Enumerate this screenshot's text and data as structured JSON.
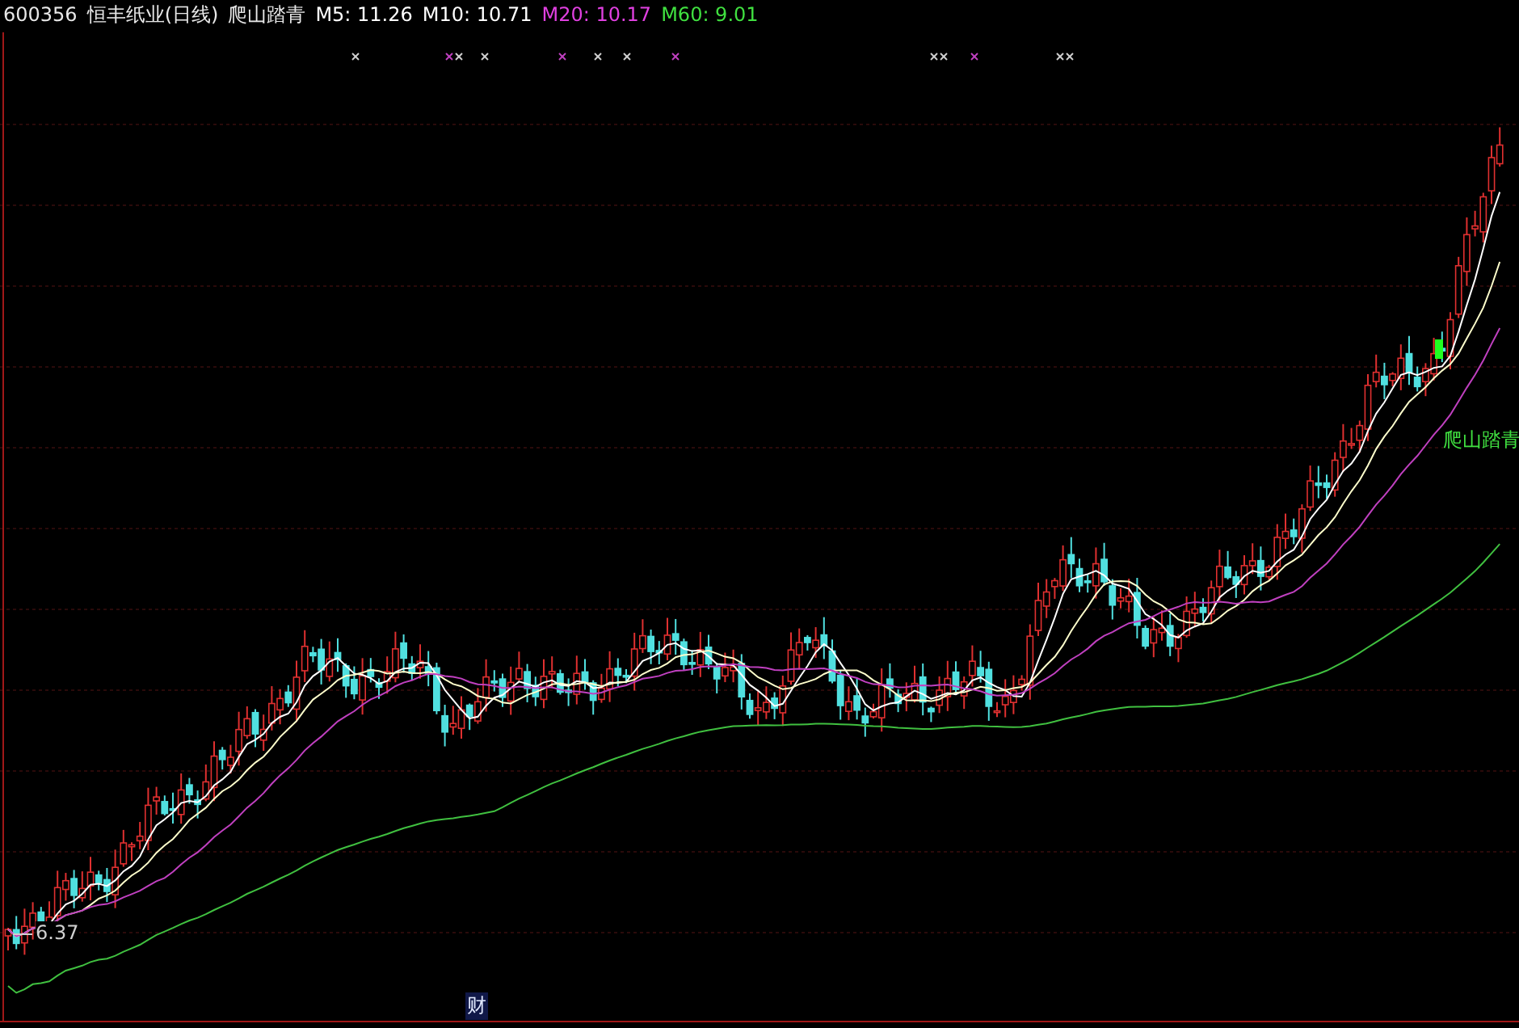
{
  "header": {
    "code": "600356",
    "title": "恒丰纸业(日线)",
    "indicator": "爬山踏青"
  },
  "moving_averages": [
    {
      "text": "M5: 11.26",
      "color": "#ffffff"
    },
    {
      "text": "M10: 10.71",
      "color": "#ffffff"
    },
    {
      "text": "M20: 10.17",
      "color": "#e040e0"
    },
    {
      "text": "M60: 9.01",
      "color": "#40e040"
    }
  ],
  "price_label": "6.37",
  "signal_label": "爬山踏青",
  "finance_badge": "财"
}
